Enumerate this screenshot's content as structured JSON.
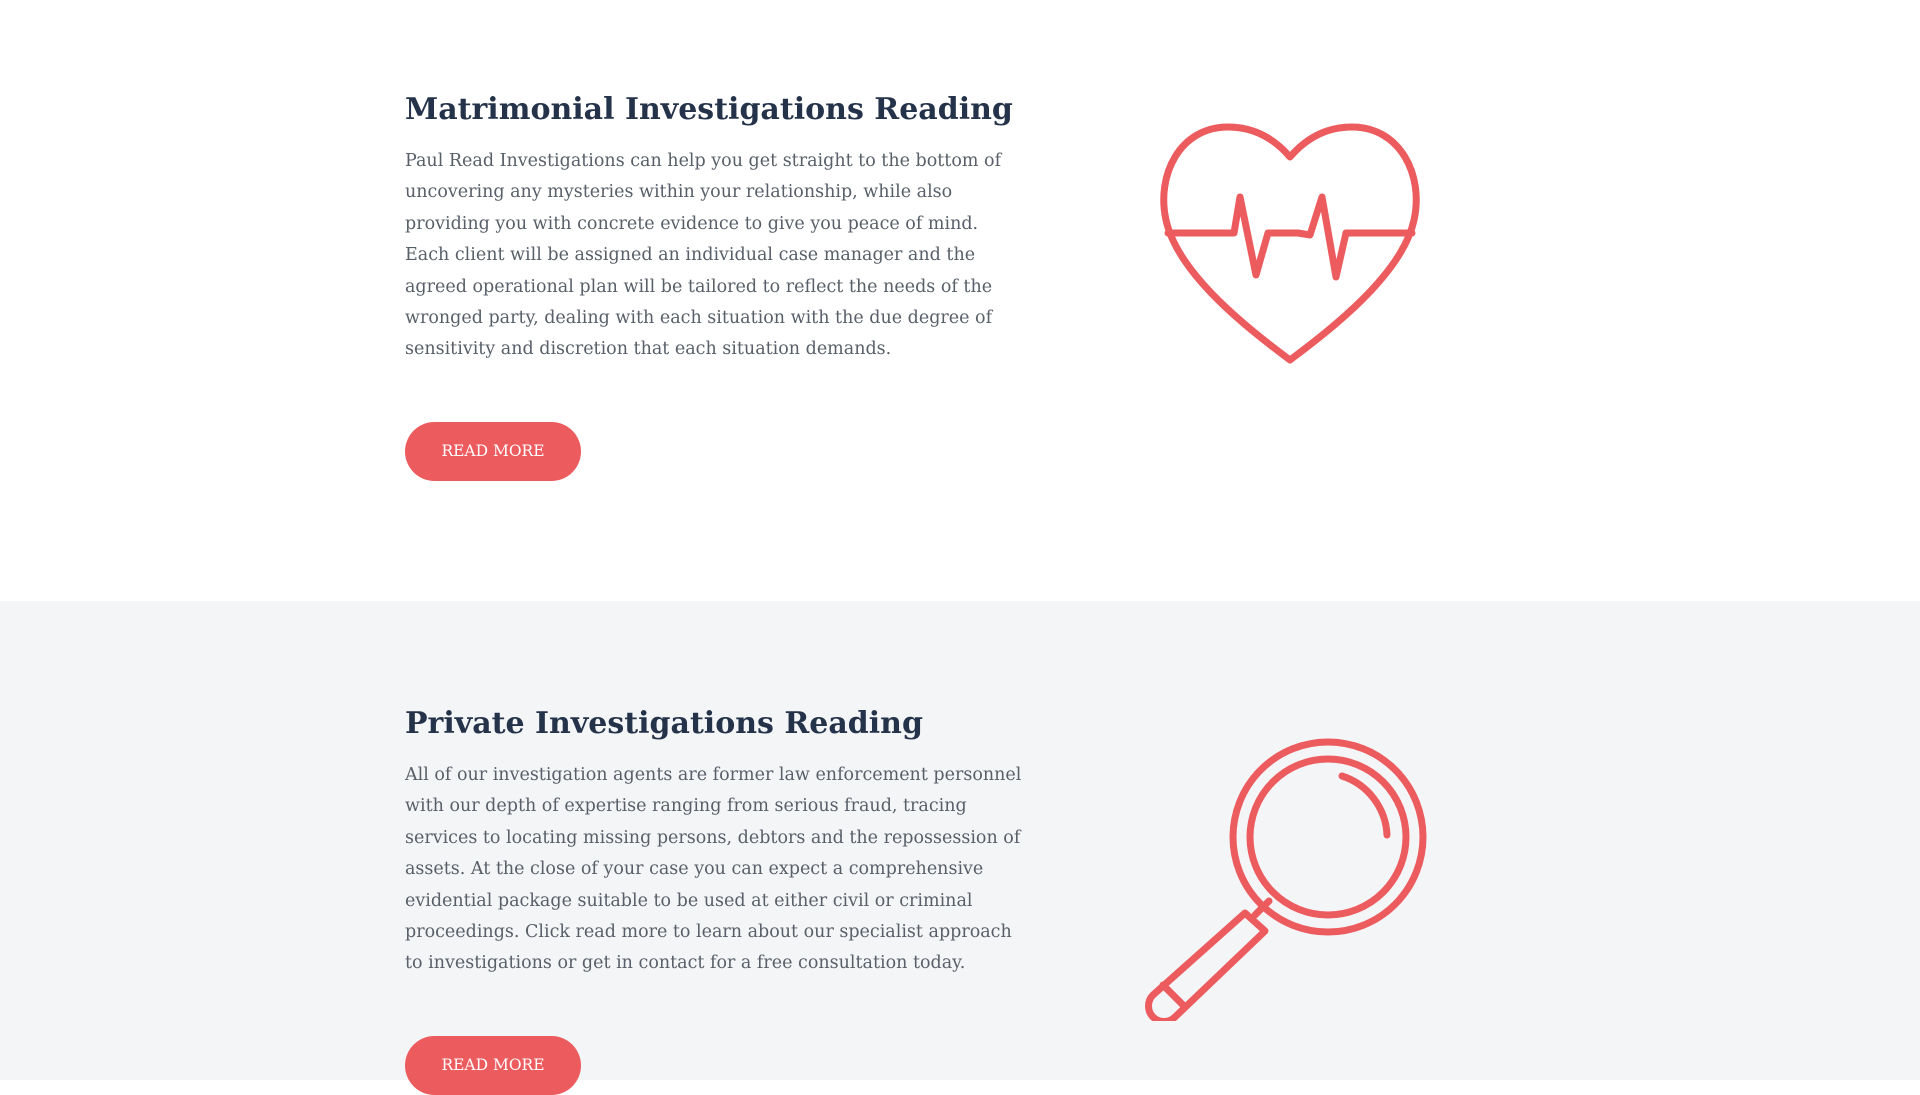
{
  "sections": [
    {
      "title": "Matrimonial Investigations Reading",
      "body": "Paul Read Investigations can help you get straight to the bottom of uncovering any mysteries within your relationship, while also providing you with concrete evidence to give you peace of mind. Each client will be assigned an individual case manager and the agreed operational plan will be tailored to reflect the needs of the wronged party, dealing with each situation with the due degree of sensitivity and discretion that each situation demands.",
      "button_label": "READ MORE",
      "icon": "heart-pulse-icon"
    },
    {
      "title": "Private Investigations Reading",
      "body": "All of our investigation agents are former law enforcement personnel with our depth of expertise ranging from serious fraud, tracing services to locating missing persons, debtors and the repossession of assets. At the close of your case you can expect a comprehensive evidential package suitable to be used at either civil or criminal proceedings. Click read more to learn about our specialist approach to investigations or get in contact for a free consultation today.",
      "button_label": "READ MORE",
      "icon": "magnifying-glass-icon"
    }
  ],
  "colors": {
    "accent": "#ec5b5e",
    "heading": "#25334a",
    "body_text": "#585f68",
    "alt_background": "#f4f5f7"
  }
}
